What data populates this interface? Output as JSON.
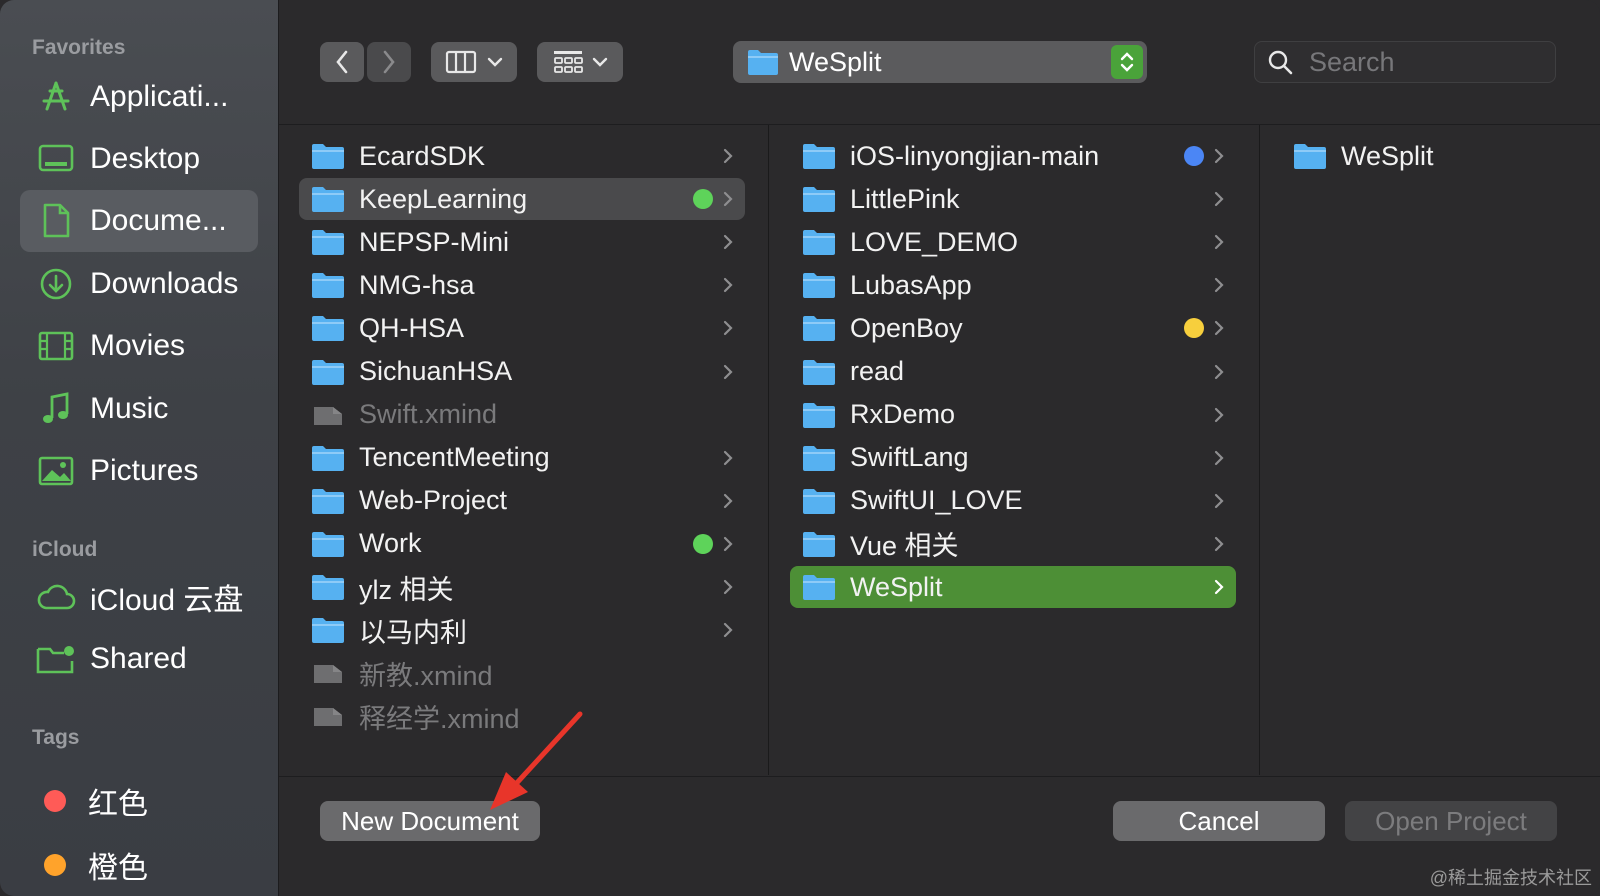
{
  "sidebar": {
    "favorites_title": "Favorites",
    "icloud_title": "iCloud",
    "tags_title": "Tags",
    "favorites": [
      {
        "label": "Applicati...",
        "icon": "applications-icon"
      },
      {
        "label": "Desktop",
        "icon": "desktop-icon"
      },
      {
        "label": "Docume...",
        "icon": "document-icon",
        "selected": true
      },
      {
        "label": "Downloads",
        "icon": "downloads-icon"
      },
      {
        "label": "Movies",
        "icon": "movies-icon"
      },
      {
        "label": "Music",
        "icon": "music-icon"
      },
      {
        "label": "Pictures",
        "icon": "pictures-icon"
      }
    ],
    "icloud": [
      {
        "label": "iCloud 云盘",
        "icon": "cloud-icon"
      },
      {
        "label": "Shared",
        "icon": "shared-folder-icon"
      }
    ],
    "tags": [
      {
        "label": "红色",
        "color": "#ff5b57"
      },
      {
        "label": "橙色",
        "color": "#ffa32b"
      }
    ]
  },
  "toolbar": {
    "path_label": "WeSplit",
    "search_placeholder": "Search"
  },
  "columns": {
    "col1": [
      {
        "name": "EcardSDK",
        "type": "folder",
        "chevron": true
      },
      {
        "name": "KeepLearning",
        "type": "folder",
        "chevron": true,
        "selected": "gray",
        "tag": "#5ed35a"
      },
      {
        "name": "NEPSP-Mini",
        "type": "folder",
        "chevron": true
      },
      {
        "name": "NMG-hsa",
        "type": "folder",
        "chevron": true
      },
      {
        "name": "QH-HSA",
        "type": "folder",
        "chevron": true
      },
      {
        "name": "SichuanHSA",
        "type": "folder",
        "chevron": true
      },
      {
        "name": "Swift.xmind",
        "type": "file",
        "dim": true
      },
      {
        "name": "TencentMeeting",
        "type": "folder",
        "chevron": true
      },
      {
        "name": "Web-Project",
        "type": "folder",
        "chevron": true
      },
      {
        "name": "Work",
        "type": "folder",
        "chevron": true,
        "tag": "#5ed35a"
      },
      {
        "name": "ylz 相关",
        "type": "folder",
        "chevron": true
      },
      {
        "name": "以马内利",
        "type": "folder",
        "chevron": true
      },
      {
        "name": "新教.xmind",
        "type": "file",
        "dim": true
      },
      {
        "name": "释经学.xmind",
        "type": "file",
        "dim": true
      }
    ],
    "col2": [
      {
        "name": "iOS-linyongjian-main",
        "type": "folder",
        "chevron": true,
        "tag": "#4b86f5"
      },
      {
        "name": "LittlePink",
        "type": "folder",
        "chevron": true
      },
      {
        "name": "LOVE_DEMO",
        "type": "folder",
        "chevron": true
      },
      {
        "name": "LubasApp",
        "type": "folder",
        "chevron": true
      },
      {
        "name": "OpenBoy",
        "type": "folder",
        "chevron": true,
        "tag": "#f7cf3d"
      },
      {
        "name": "read",
        "type": "folder",
        "chevron": true
      },
      {
        "name": "RxDemo",
        "type": "folder",
        "chevron": true
      },
      {
        "name": "SwiftLang",
        "type": "folder",
        "chevron": true
      },
      {
        "name": "SwiftUI_LOVE",
        "type": "folder",
        "chevron": true
      },
      {
        "name": "Vue 相关",
        "type": "folder",
        "chevron": true
      },
      {
        "name": "WeSplit",
        "type": "folder",
        "chevron": true,
        "selected": "green"
      }
    ],
    "col3": [
      {
        "name": "WeSplit",
        "type": "folder",
        "chevron": false
      }
    ]
  },
  "buttons": {
    "new_document": "New Document",
    "cancel": "Cancel",
    "open_project": "Open Project"
  },
  "watermark": "@稀土掘金技术社区",
  "colors": {
    "folder_blue": "#56b1f1",
    "selection_green": "#4d8f36",
    "accent_green": "#4aa33a"
  }
}
